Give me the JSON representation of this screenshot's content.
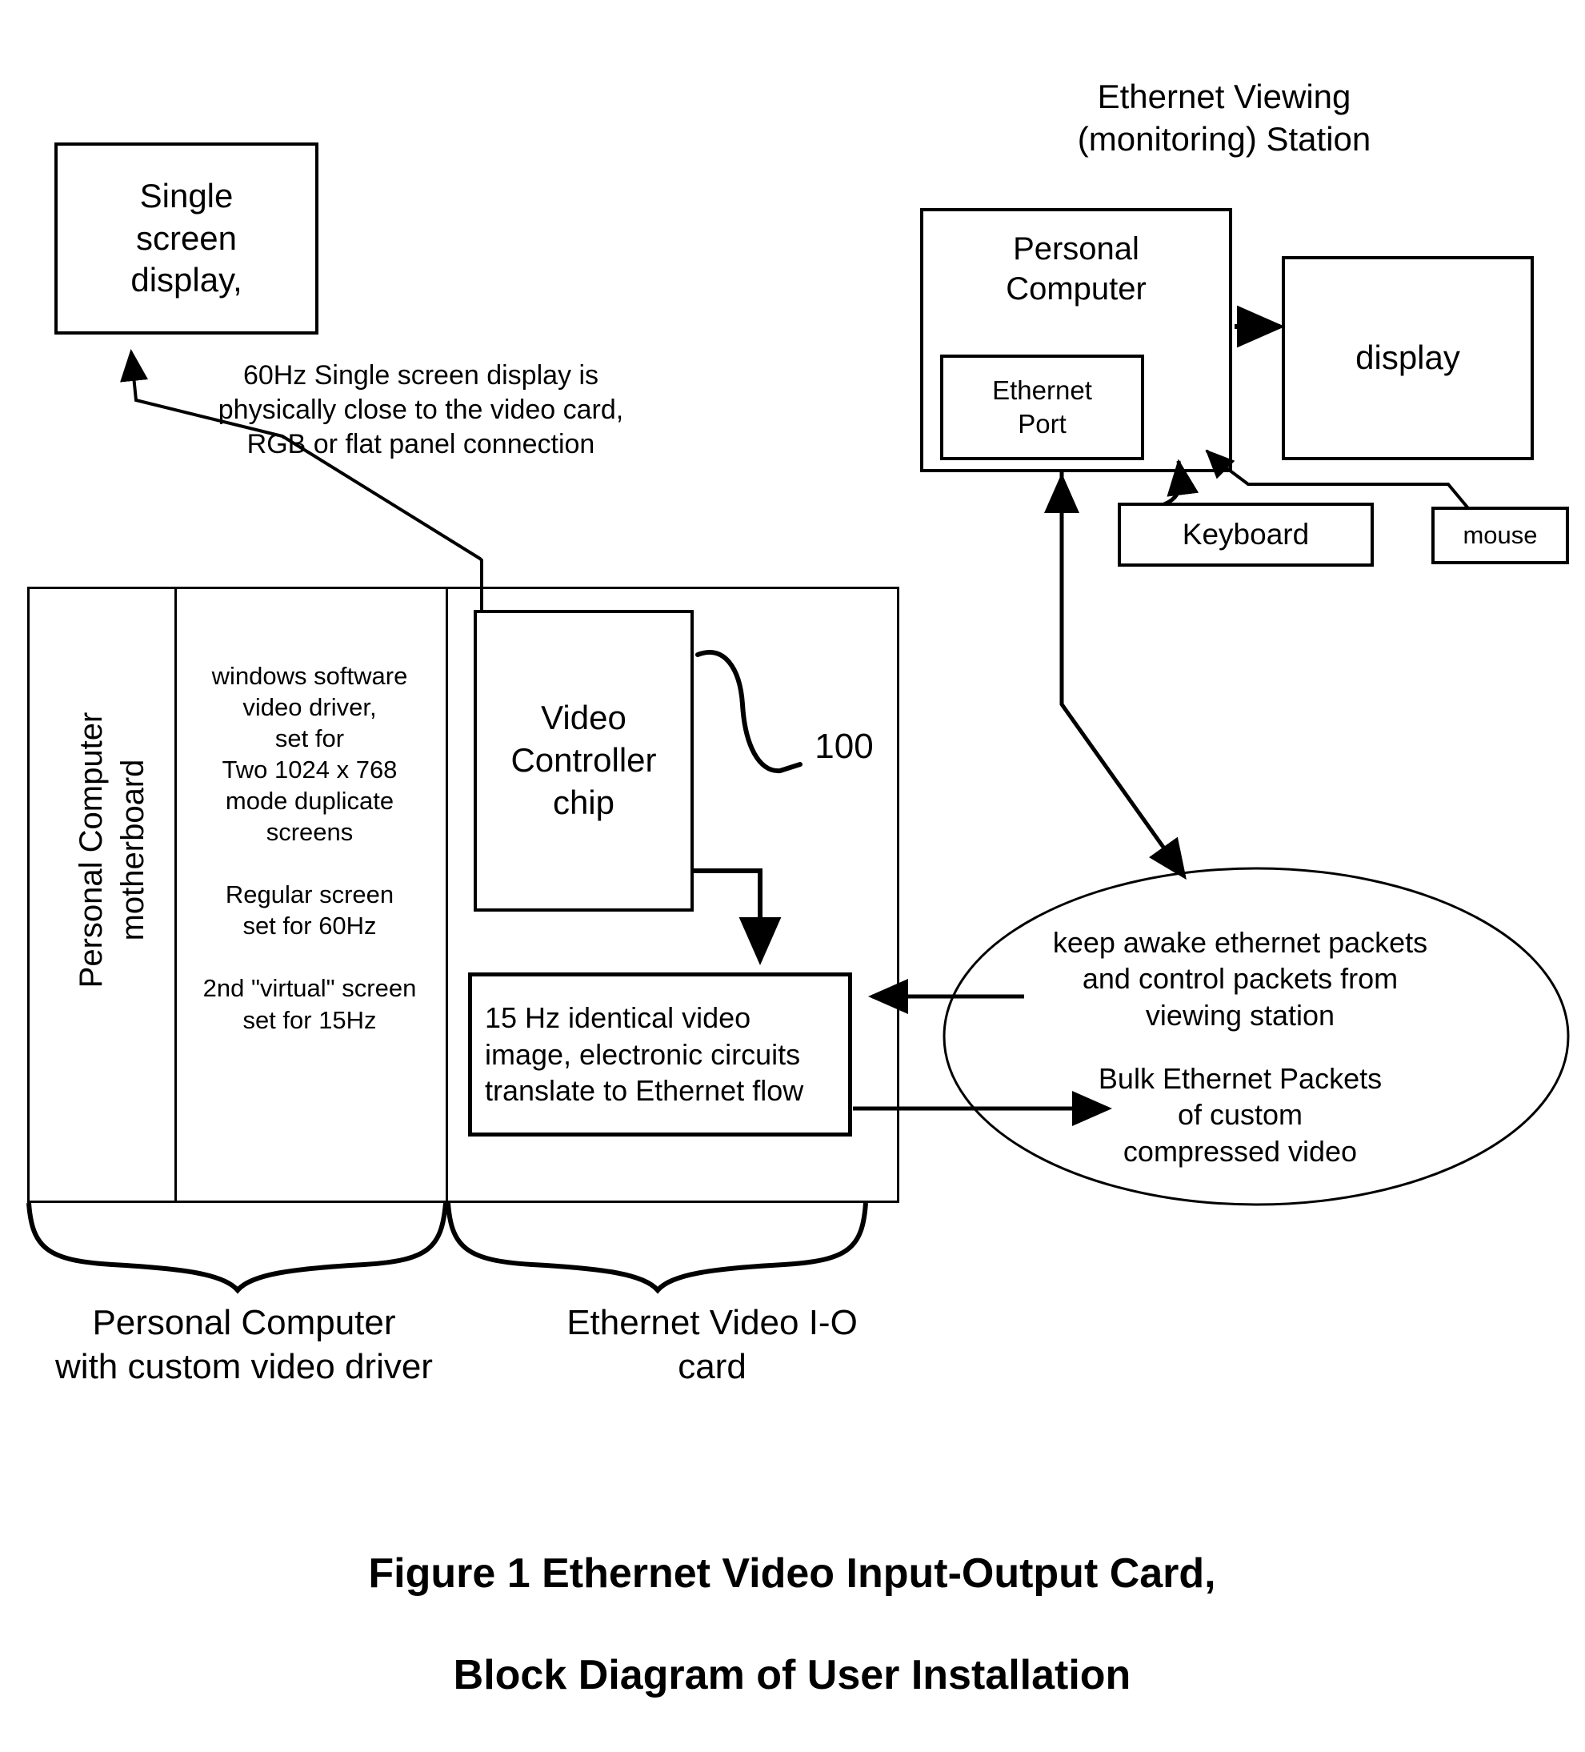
{
  "figure": {
    "caption_line1": "Figure 1 Ethernet Video Input-Output Card,",
    "caption_line2": "Block Diagram of User Installation"
  },
  "left_system": {
    "single_screen_display": "Single\nscreen\ndisplay,",
    "single_screen_note": "60Hz Single screen display is\nphysically close to the video card,\nRGB or flat panel connection",
    "motherboard_label": "Personal Computer\nmotherboard",
    "driver_text": "windows software\nvideo driver,\nset for\nTwo 1024 x 768\nmode duplicate\nscreens\n\nRegular screen\nset for 60Hz\n\n2nd \"virtual\" screen\nset for 15Hz",
    "video_controller_chip": "Video\nController\nchip",
    "reference_numeral": "100",
    "ethernet_flow_box": "15 Hz identical video\nimage, electronic circuits\ntranslate to Ethernet flow",
    "brace_label_left": "Personal Computer\nwith custom video driver",
    "brace_label_right": "Ethernet Video I-O\ncard"
  },
  "viewing_station": {
    "title": "Ethernet Viewing\n(monitoring) Station",
    "personal_computer": "Personal\nComputer",
    "ethernet_port": "Ethernet\nPort",
    "display": "display",
    "keyboard": "Keyboard",
    "mouse": "mouse"
  },
  "network_cloud": {
    "text_top": "keep awake ethernet packets\nand control packets from\nviewing station",
    "text_bottom": "Bulk Ethernet Packets\nof custom\ncompressed video"
  },
  "colors": {
    "stroke": "#000000",
    "background": "#ffffff"
  }
}
